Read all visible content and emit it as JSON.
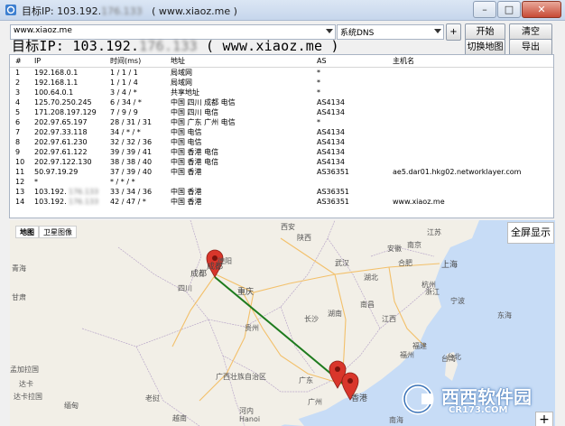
{
  "window": {
    "title": "目标IP: 103.192.",
    "title_suffix": "( www.xiaoz.me )",
    "minimize": "–",
    "maximize": "□",
    "close": "✕"
  },
  "controls": {
    "target_value": "www.xiaoz.me",
    "dns_value": "系统DNS",
    "add_label": "+",
    "start_label": "开始",
    "clear_label": "清空",
    "switch_map_label": "切换地图",
    "export_label": "导出"
  },
  "heading": {
    "prefix": "目标IP: 103.192.",
    "suffix": "( www.xiaoz.me )"
  },
  "table": {
    "columns": [
      "#",
      "IP",
      "时间(ms)",
      "地址",
      "AS",
      "主机名"
    ],
    "rows": [
      {
        "n": "1",
        "ip": "192.168.0.1",
        "time": "1 / 1 / 1",
        "addr": "局域网",
        "as": "*",
        "host": "",
        "blur": false
      },
      {
        "n": "2",
        "ip": "192.168.1.1",
        "time": "1 / 1 / 4",
        "addr": "局域网",
        "as": "*",
        "host": "",
        "blur": false
      },
      {
        "n": "3",
        "ip": "100.64.0.1",
        "time": "3 / 4 / *",
        "addr": "共享地址",
        "as": "*",
        "host": "",
        "blur": false
      },
      {
        "n": "4",
        "ip": "125.70.250.245",
        "time": "6 / 34 / *",
        "addr": "中国 四川 成都 电信",
        "as": "AS4134",
        "host": "",
        "blur": false
      },
      {
        "n": "5",
        "ip": "171.208.197.129",
        "time": "7 / 9 / 9",
        "addr": "中国 四川 电信",
        "as": "AS4134",
        "host": "",
        "blur": false
      },
      {
        "n": "6",
        "ip": "202.97.65.197",
        "time": "28 / 31 / 31",
        "addr": "中国 广东 广州 电信",
        "as": "*",
        "host": "",
        "blur": false
      },
      {
        "n": "7",
        "ip": "202.97.33.118",
        "time": "34 / * / *",
        "addr": "中国 电信",
        "as": "AS4134",
        "host": "",
        "blur": false
      },
      {
        "n": "8",
        "ip": "202.97.61.230",
        "time": "32 / 32 / 36",
        "addr": "中国 电信",
        "as": "AS4134",
        "host": "",
        "blur": false
      },
      {
        "n": "9",
        "ip": "202.97.61.122",
        "time": "39 / 39 / 41",
        "addr": "中国 香港 电信",
        "as": "AS4134",
        "host": "",
        "blur": false
      },
      {
        "n": "10",
        "ip": "202.97.122.130",
        "time": "38 / 38 / 40",
        "addr": "中国 香港 电信",
        "as": "AS4134",
        "host": "",
        "blur": false
      },
      {
        "n": "11",
        "ip": "50.97.19.29",
        "time": "37 / 39 / 40",
        "addr": "中国 香港",
        "as": "AS36351",
        "host": "ae5.dar01.hkg02.networklayer.com",
        "blur": false
      },
      {
        "n": "12",
        "ip": "*",
        "time": "* / * / *",
        "addr": "",
        "as": "",
        "host": "",
        "blur": false
      },
      {
        "n": "13",
        "ip": "103.192.",
        "time": "33 / 34 / 36",
        "addr": "中国 香港",
        "as": "AS36351",
        "host": "",
        "blur": true
      },
      {
        "n": "14",
        "ip": "103.192.",
        "time": "42 / 47 / *",
        "addr": "中国 香港",
        "as": "AS36351",
        "host": "www.xiaoz.me",
        "blur": true
      }
    ]
  },
  "map": {
    "tab_map": "地图",
    "tab_satellite": "卫星图像",
    "fullscreen_label": "全屏显示",
    "zoom_in": "+",
    "pin_start_label": "成都",
    "pin_end_label": "香港",
    "labels": [
      {
        "text": "青海",
        "cls": ""
      },
      {
        "text": "四川",
        "cls": ""
      },
      {
        "text": "成都",
        "cls": "big"
      },
      {
        "text": "重庆",
        "cls": "big"
      },
      {
        "text": "甘肃",
        "cls": ""
      },
      {
        "text": "陕西",
        "cls": ""
      },
      {
        "text": "湖北",
        "cls": ""
      },
      {
        "text": "湖南",
        "cls": ""
      },
      {
        "text": "贵州",
        "cls": ""
      },
      {
        "text": "广西壮族自治区",
        "cls": ""
      },
      {
        "text": "广东",
        "cls": ""
      },
      {
        "text": "江西",
        "cls": ""
      },
      {
        "text": "福建",
        "cls": ""
      },
      {
        "text": "浙江",
        "cls": ""
      },
      {
        "text": "安徽",
        "cls": ""
      },
      {
        "text": "江苏",
        "cls": ""
      },
      {
        "text": "上海",
        "cls": "big"
      },
      {
        "text": "杭州",
        "cls": ""
      },
      {
        "text": "台湾",
        "cls": ""
      },
      {
        "text": "台北",
        "cls": ""
      },
      {
        "text": "南京",
        "cls": ""
      },
      {
        "text": "武汉",
        "cls": ""
      },
      {
        "text": "合肥",
        "cls": ""
      },
      {
        "text": "长沙",
        "cls": ""
      },
      {
        "text": "南昌",
        "cls": ""
      },
      {
        "text": "西安",
        "cls": ""
      },
      {
        "text": "福州",
        "cls": ""
      },
      {
        "text": "宁波",
        "cls": ""
      },
      {
        "text": "德阳",
        "cls": ""
      },
      {
        "text": "河内",
        "cls": ""
      },
      {
        "text": "Hanoi",
        "cls": ""
      },
      {
        "text": "达卡",
        "cls": ""
      },
      {
        "text": "孟加拉国",
        "cls": ""
      },
      {
        "text": "达卡拉国",
        "cls": ""
      },
      {
        "text": "东海",
        "cls": ""
      },
      {
        "text": "越南",
        "cls": ""
      },
      {
        "text": "老挝",
        "cls": ""
      },
      {
        "text": "缅甸",
        "cls": ""
      },
      {
        "text": "广州",
        "cls": ""
      },
      {
        "text": "南海",
        "cls": ""
      }
    ]
  },
  "watermark": {
    "text": "西西软件园",
    "sub": "CR173.COM"
  },
  "colors": {
    "route": "#1e7b1e",
    "pin": "#d9362b",
    "water": "#c7dcf6",
    "land": "#f2efe7"
  }
}
